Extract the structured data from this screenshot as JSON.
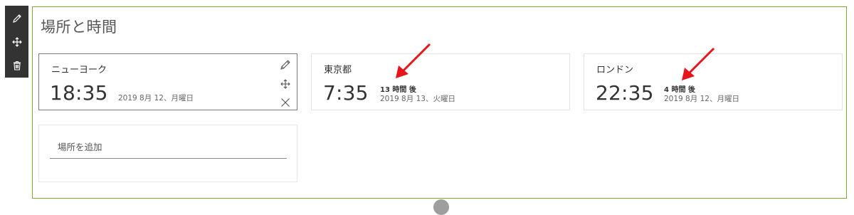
{
  "toolbar": {
    "items": [
      {
        "name": "edit",
        "icon": "pencil-icon"
      },
      {
        "name": "move",
        "icon": "move-icon"
      },
      {
        "name": "delete",
        "icon": "trash-icon"
      }
    ]
  },
  "webpart": {
    "title": "場所と時間",
    "border_color": "#7bab3a"
  },
  "cards": [
    {
      "location": "ニューヨーク",
      "time": "18:35",
      "offset": "",
      "date": "2019 8月 12、月曜日",
      "selected": true,
      "actions": [
        "pencil-icon",
        "move-icon",
        "close-icon"
      ]
    },
    {
      "location": "東京都",
      "time": "7:35",
      "offset": "13 時間 後",
      "date": "2019 8月 13、火曜日",
      "selected": false
    },
    {
      "location": "ロンドン",
      "time": "22:35",
      "offset": "4 時間 後",
      "date": "2019 8月 12、月曜日",
      "selected": false
    }
  ],
  "add_location": {
    "placeholder": "場所を追加",
    "value": ""
  },
  "annotations": {
    "arrow_color": "#e8141b"
  }
}
